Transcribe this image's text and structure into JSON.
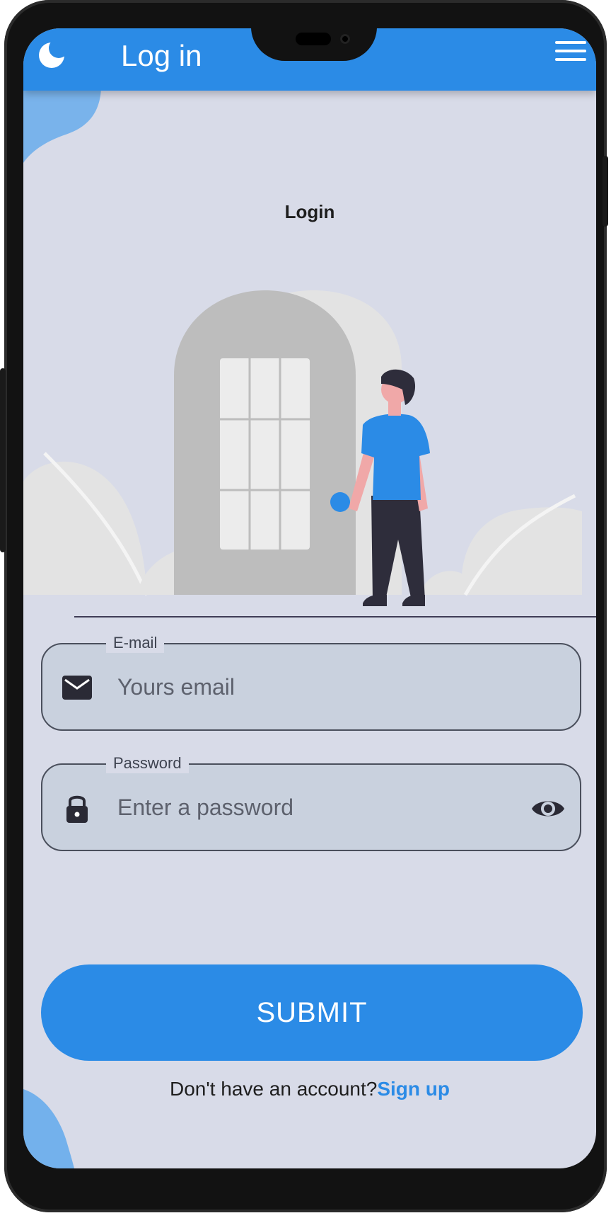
{
  "app_bar": {
    "title": "Log in",
    "theme_icon": "moon-icon",
    "menu_icon": "hamburger-menu-icon"
  },
  "page": {
    "title": "Login"
  },
  "illustration": {
    "name": "person-at-door-illustration"
  },
  "form": {
    "email": {
      "label": "E-mail",
      "placeholder": "Yours email",
      "value": "",
      "icon": "envelope-icon"
    },
    "password": {
      "label": "Password",
      "placeholder": "Enter a password",
      "value": "",
      "icon": "lock-icon",
      "toggle_icon": "eye-icon"
    },
    "submit_label": "SUBMIT"
  },
  "footer": {
    "prompt": "Don't have an account?",
    "link": "Sign up"
  },
  "colors": {
    "primary": "#2b8be6",
    "background": "#d8dbe8",
    "field_fill": "#c9d1de",
    "text": "#1e1e1e"
  }
}
